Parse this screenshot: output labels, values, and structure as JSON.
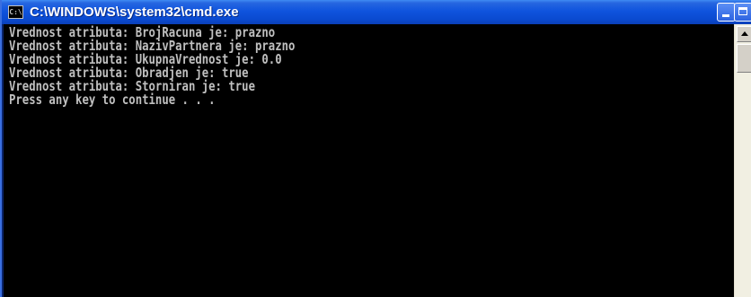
{
  "window": {
    "title": "C:\\WINDOWS\\system32\\cmd.exe",
    "icon": "cmd-icon",
    "icon_glyph": "C:\\",
    "controls": {
      "minimize": "minimize-icon",
      "maximize": "maximize-icon",
      "close": "close-icon",
      "close_glyph": "×"
    }
  },
  "console": {
    "background": "#000000",
    "foreground": "#c0c0c0",
    "lines": [
      "Vrednost atributa: BrojRacuna je: prazno",
      "Vrednost atributa: NazivPartnera je: prazno",
      "Vrednost atributa: UkupnaVrednost je: 0.0",
      "Vrednost atributa: Obradjen je: true",
      "Vrednost atributa: Storniran je: true",
      "Press any key to continue . . ."
    ]
  },
  "colors": {
    "titlebar": "#0f54de",
    "scrollbar_track": "#f1efe2",
    "close_button": "#c9421f"
  }
}
